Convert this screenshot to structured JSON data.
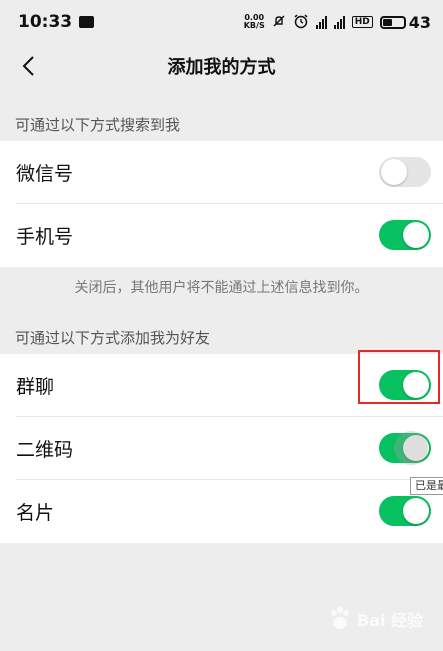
{
  "status_bar": {
    "time": "10:33",
    "net_speed_value": "0.00",
    "net_speed_unit": "KB/S",
    "hd_badge": "HD",
    "battery_level": "43",
    "icons": [
      "message-icon",
      "mute-icon",
      "alarm-icon",
      "signal-icon",
      "signal-icon",
      "battery-icon"
    ]
  },
  "nav": {
    "title": "添加我的方式",
    "back_icon": "chevron-left-icon"
  },
  "section_search": {
    "header": "可通过以下方式搜索到我",
    "items": [
      {
        "label": "微信号",
        "enabled": false
      },
      {
        "label": "手机号",
        "enabled": true
      }
    ],
    "footnote": "关闭后，其他用户将不能通过上述信息找到你。"
  },
  "section_add": {
    "header": "可通过以下方式添加我为好友",
    "items": [
      {
        "label": "群聊",
        "enabled": true
      },
      {
        "label": "二维码",
        "enabled": true
      },
      {
        "label": "名片",
        "enabled": true
      }
    ]
  },
  "tooltip": {
    "text": "已是最"
  },
  "watermark": {
    "text": "Bai 经验"
  },
  "colors": {
    "toggle_on": "#07c160",
    "toggle_off": "#e5e5e5",
    "highlight": "#e02b2b",
    "background": "#ededed"
  }
}
